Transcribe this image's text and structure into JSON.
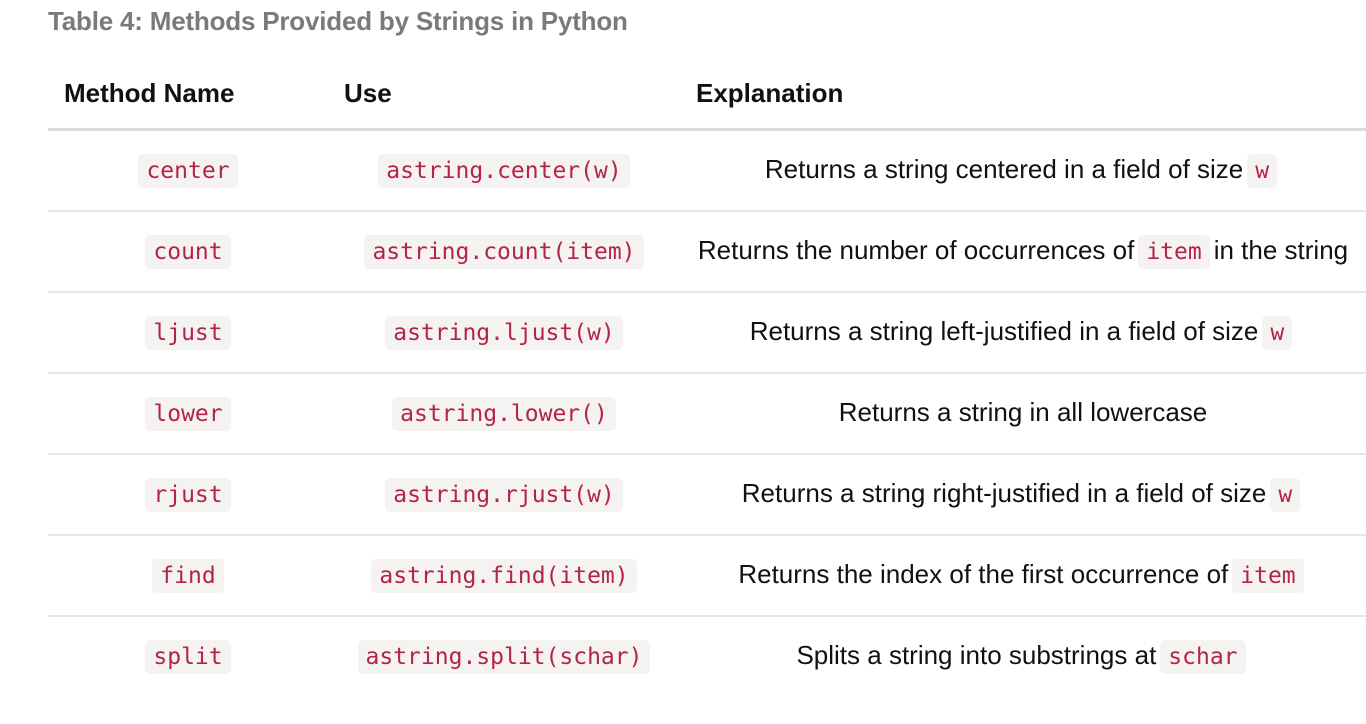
{
  "caption": "Table 4: Methods Provided by Strings in Python",
  "headers": {
    "method": "Method Name",
    "use": "Use",
    "explanation": "Explanation"
  },
  "rows": [
    {
      "method": "center",
      "use": "astring.center(w)",
      "text": "Returns a string centered in a field of size",
      "code": "w",
      "tail": ""
    },
    {
      "method": "count",
      "use": "astring.count(item)",
      "text": "Returns the number of occurrences of",
      "code": "item",
      "tail": "in the string"
    },
    {
      "method": "ljust",
      "use": "astring.ljust(w)",
      "text": "Returns a string left-justified in a field of size",
      "code": "w",
      "tail": ""
    },
    {
      "method": "lower",
      "use": "astring.lower()",
      "text": "Returns a string in all lowercase",
      "code": "",
      "tail": ""
    },
    {
      "method": "rjust",
      "use": "astring.rjust(w)",
      "text": "Returns a string right-justified in a field of size",
      "code": "w",
      "tail": ""
    },
    {
      "method": "find",
      "use": "astring.find(item)",
      "text": "Returns the index of the first occurrence of",
      "code": "item",
      "tail": ""
    },
    {
      "method": "split",
      "use": "astring.split(schar)",
      "text": "Splits a string into substrings at",
      "code": "schar",
      "tail": ""
    }
  ]
}
